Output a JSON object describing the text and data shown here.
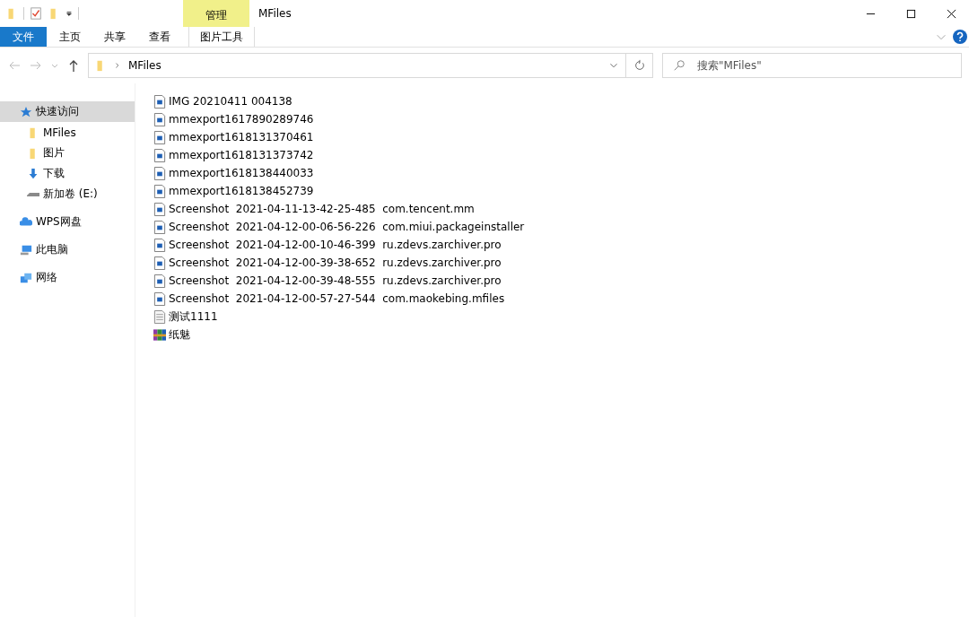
{
  "window": {
    "title": "MFiles",
    "context_tab": "管理"
  },
  "ribbon_tabs": [
    {
      "label": "文件",
      "kind": "file",
      "selected": false
    },
    {
      "label": "主页",
      "kind": "tab",
      "selected": false
    },
    {
      "label": "共享",
      "kind": "tab",
      "selected": false
    },
    {
      "label": "查看",
      "kind": "tab",
      "selected": false
    },
    {
      "label": "图片工具",
      "kind": "context",
      "selected": false
    }
  ],
  "address_bar": {
    "path": "MFiles"
  },
  "search": {
    "placeholder": "搜索\"MFiles\""
  },
  "sidebar": {
    "items": [
      {
        "label": "快速访问",
        "kind": "star",
        "selected": true,
        "children": [
          {
            "label": "MFiles",
            "kind": "folder",
            "selected": false
          },
          {
            "label": "图片",
            "kind": "folder",
            "selected": false
          },
          {
            "label": "下载",
            "kind": "download",
            "selected": false
          },
          {
            "label": "新加卷 (E:)",
            "kind": "drive",
            "selected": false
          }
        ]
      },
      {
        "label": "WPS网盘",
        "kind": "cloud",
        "selected": false
      },
      {
        "label": "此电脑",
        "kind": "pc",
        "selected": false
      },
      {
        "label": "网络",
        "kind": "network",
        "selected": false
      }
    ]
  },
  "files": [
    {
      "name": "IMG 20210411 004138",
      "kind": "image"
    },
    {
      "name": "mmexport1617890289746",
      "kind": "image"
    },
    {
      "name": "mmexport1618131370461",
      "kind": "image"
    },
    {
      "name": "mmexport1618131373742",
      "kind": "image"
    },
    {
      "name": "mmexport1618138440033",
      "kind": "image"
    },
    {
      "name": "mmexport1618138452739",
      "kind": "image"
    },
    {
      "name": "Screenshot  2021-04-11-13-42-25-485  com.tencent.mm",
      "kind": "image"
    },
    {
      "name": "Screenshot  2021-04-12-00-06-56-226  com.miui.packageinstaller",
      "kind": "image"
    },
    {
      "name": "Screenshot  2021-04-12-00-10-46-399  ru.zdevs.zarchiver.pro",
      "kind": "image"
    },
    {
      "name": "Screenshot  2021-04-12-00-39-38-652  ru.zdevs.zarchiver.pro",
      "kind": "image"
    },
    {
      "name": "Screenshot  2021-04-12-00-39-48-555  ru.zdevs.zarchiver.pro",
      "kind": "image"
    },
    {
      "name": "Screenshot  2021-04-12-00-57-27-544  com.maokebing.mfiles",
      "kind": "image"
    },
    {
      "name": "测试1111",
      "kind": "text"
    },
    {
      "name": "纸魅",
      "kind": "archive"
    }
  ]
}
